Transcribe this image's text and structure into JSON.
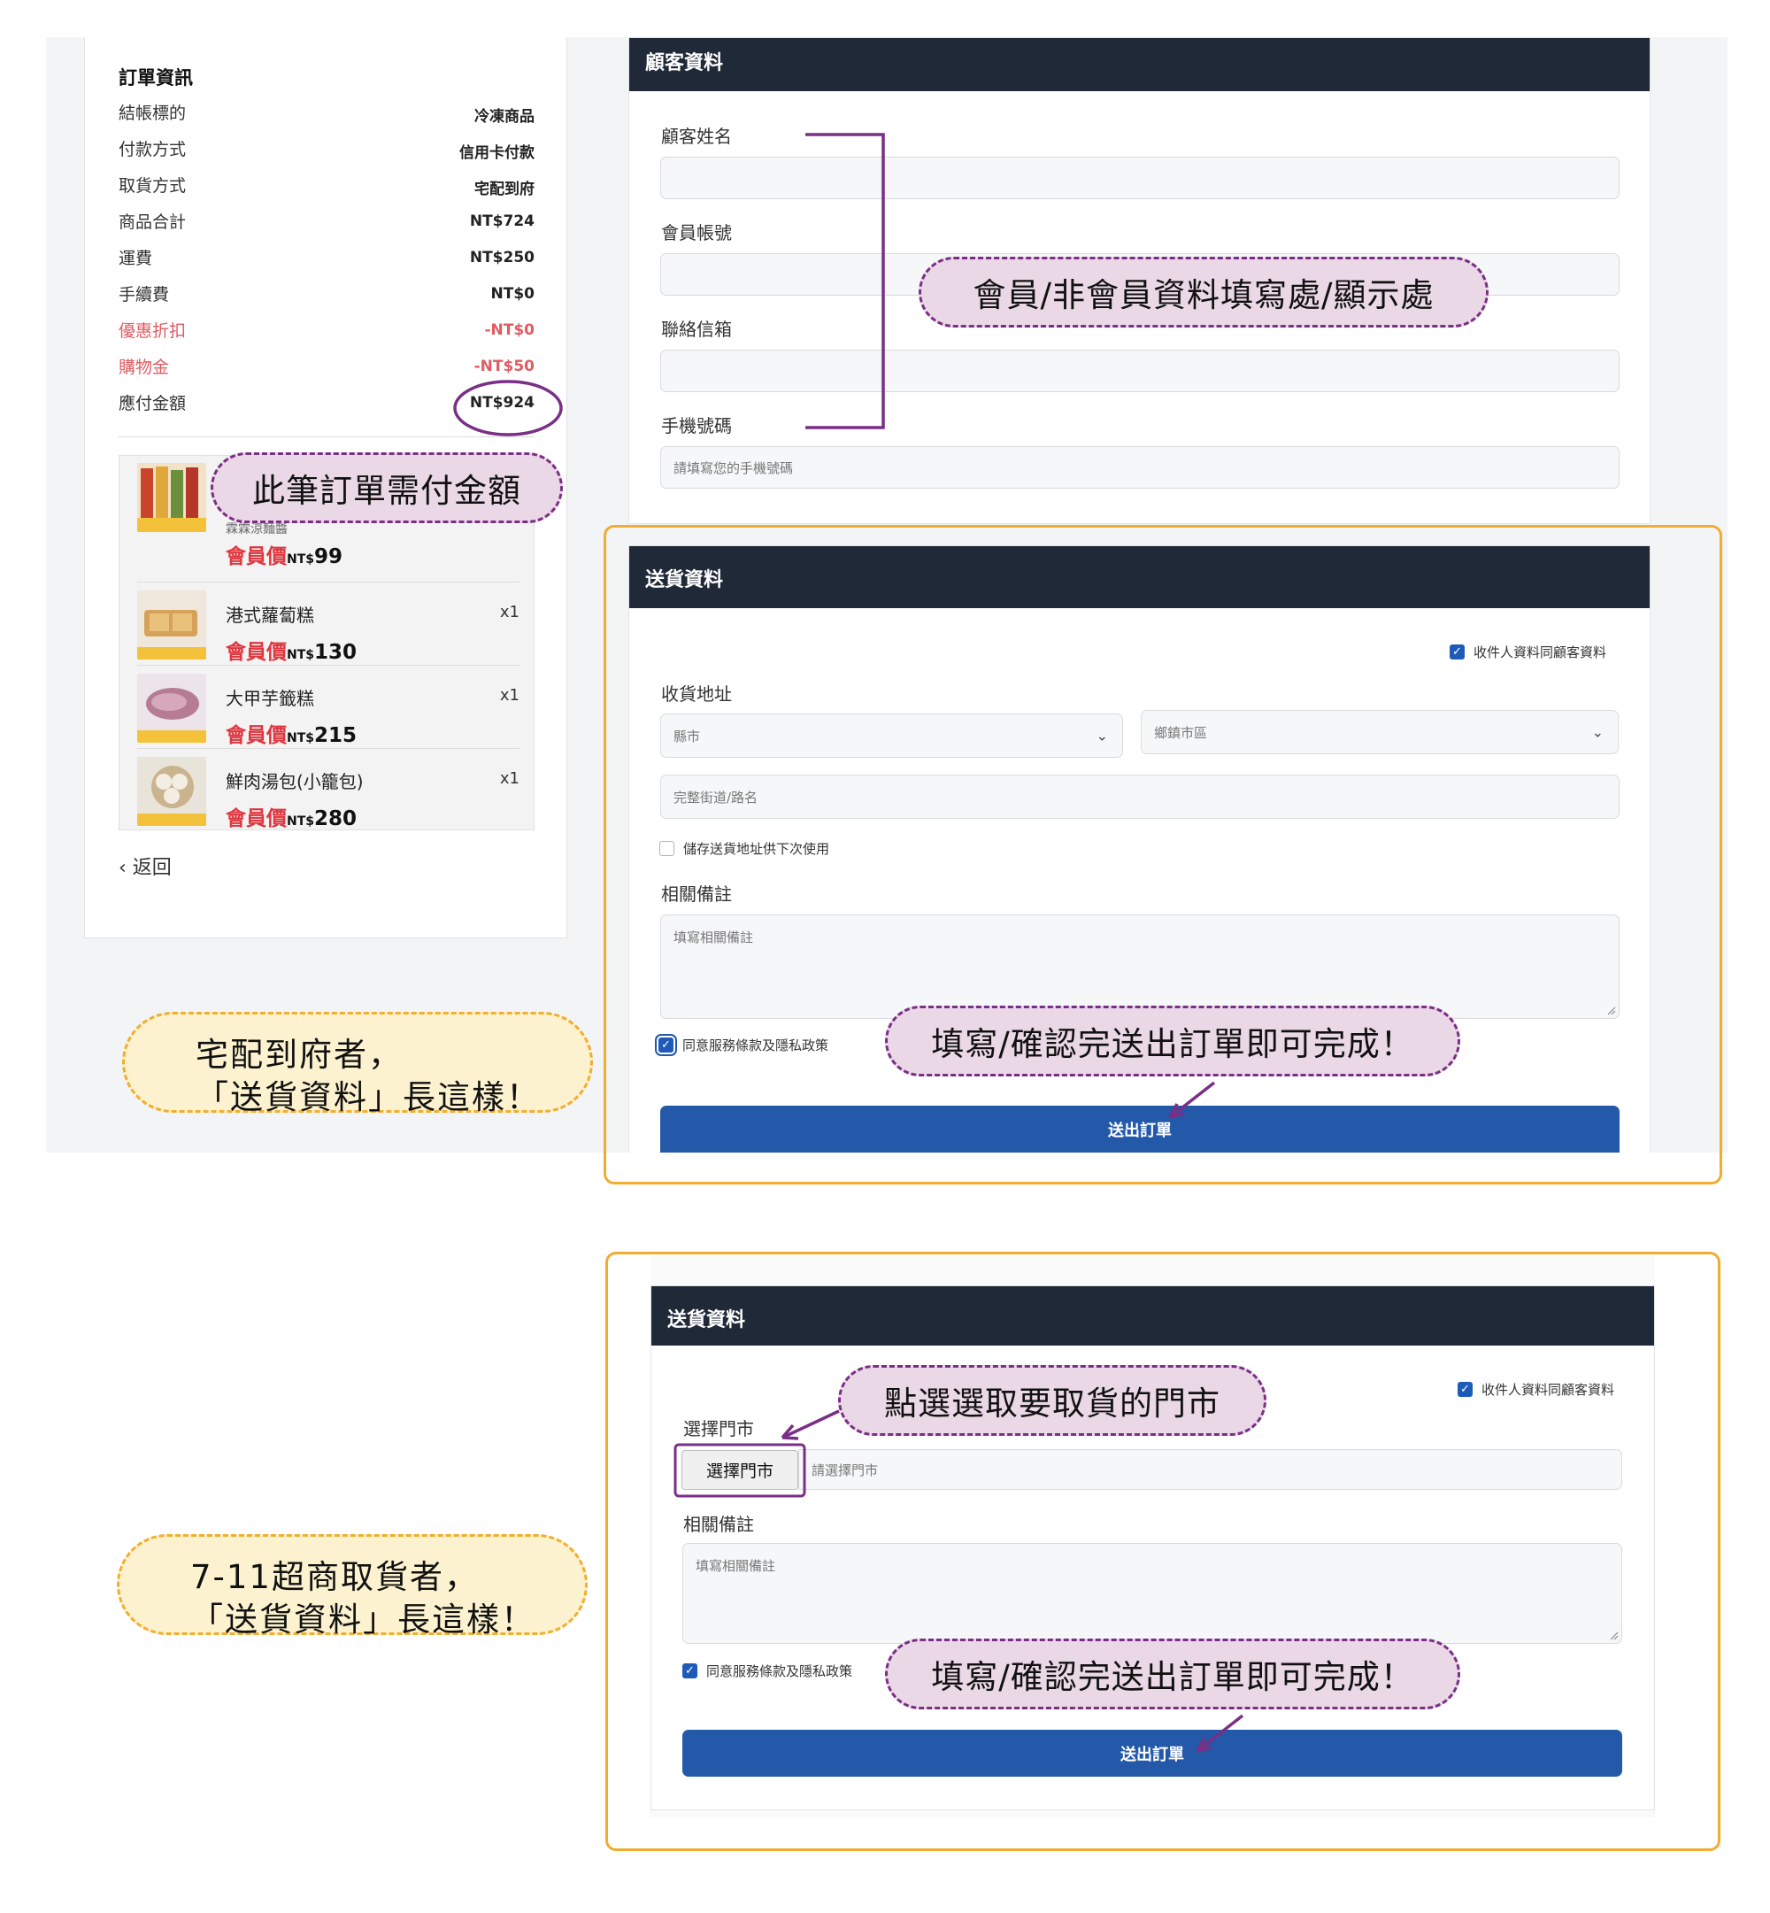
{
  "order": {
    "title": "訂單資訊",
    "rows": [
      {
        "label": "結帳標的",
        "value": "冷凍商品"
      },
      {
        "label": "付款方式",
        "value": "信用卡付款"
      },
      {
        "label": "取貨方式",
        "value": "宅配到府"
      },
      {
        "label": "商品合計",
        "value": "NT$724"
      },
      {
        "label": "運費",
        "value": "NT$250"
      },
      {
        "label": "手續費",
        "value": "NT$0"
      },
      {
        "label": "優惠折扣",
        "value": "-NT$0"
      },
      {
        "label": "購物金",
        "value": "-NT$50"
      },
      {
        "label": "應付金額",
        "value": "NT$924"
      }
    ],
    "items": [
      {
        "name": "霖霖涼麵醬",
        "qty": "",
        "tag": "會員價",
        "currency": "NT$",
        "price": "99",
        "thumb_label": "涼麵醬"
      },
      {
        "name": "港式蘿蔔糕",
        "qty": "x1",
        "tag": "會員價",
        "currency": "NT$",
        "price": "130",
        "thumb_label": "港式蘿蔔糕"
      },
      {
        "name": "大甲芋籤糕",
        "qty": "x1",
        "tag": "會員價",
        "currency": "NT$",
        "price": "215",
        "thumb_label": "大甲芋籤糕"
      },
      {
        "name": "鮮肉湯包(小籠包)",
        "qty": "x1",
        "tag": "會員價",
        "currency": "NT$",
        "price": "280",
        "thumb_label": "鮮肉湯包"
      }
    ],
    "back": "返回"
  },
  "customer": {
    "title": "顧客資料",
    "name_label": "顧客姓名",
    "account_label": "會員帳號",
    "email_label": "聯絡信箱",
    "phone_label": "手機號碼",
    "phone_placeholder": "請填寫您的手機號碼"
  },
  "delivery": {
    "title": "送貨資料",
    "same_as_customer": "收件人資料同顧客資料",
    "address_label": "收貨地址",
    "city_placeholder": "縣市",
    "district_placeholder": "鄉鎮市區",
    "street_placeholder": "完整街道/路名",
    "save_address": "儲存送貨地址供下次使用",
    "note_label": "相關備註",
    "note_placeholder": "填寫相關備註",
    "agree": "同意服務條款及隱私政策",
    "submit": "送出訂單"
  },
  "store": {
    "title": "送貨資料",
    "same_as_customer": "收件人資料同顧客資料",
    "store_label": "選擇門市",
    "store_button": "選擇門市",
    "store_placeholder": "請選擇門市",
    "note_label": "相關備註",
    "note_placeholder": "填寫相關備註",
    "agree": "同意服務條款及隱私政策",
    "submit": "送出訂單"
  },
  "annotations": {
    "member_info": "會員/非會員資料填寫處/顯示處",
    "amount_due": "此筆訂單需付金額",
    "finish_home": "填寫/確認完送出訂單即可完成！",
    "home_line1": "宅配到府者，",
    "home_line2": "「送貨資料」長這樣！",
    "pick_store": "點選選取要取貨的門市",
    "finish_store": "填寫/確認完送出訂單即可完成！",
    "store_line1": "7-11超商取貨者，",
    "store_line2": "「送貨資料」長這樣！"
  },
  "colors": {
    "header_dark": "#1f2937",
    "submit_blue": "#2458a8",
    "discount_red": "#e05b62",
    "member_price_red": "#e0363f",
    "annotation_purple": "#7a2f86",
    "frame_orange": "#f0ad2f"
  }
}
